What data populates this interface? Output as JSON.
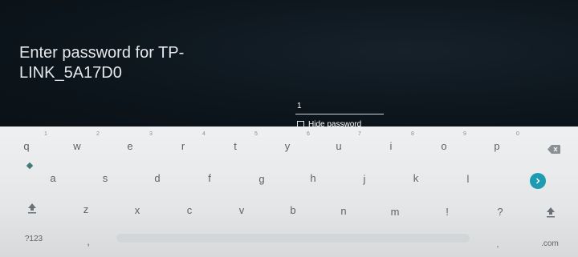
{
  "title": "Enter password for TP-\nLINK_5A17D0",
  "password_field": {
    "value": "1"
  },
  "hide_password_label": "Hide password",
  "keyboard": {
    "row1": [
      "q",
      "w",
      "e",
      "r",
      "t",
      "y",
      "u",
      "i",
      "o",
      "p"
    ],
    "row1_hints": [
      "1",
      "2",
      "3",
      "4",
      "5",
      "6",
      "7",
      "8",
      "9",
      "0"
    ],
    "row2": [
      "a",
      "s",
      "d",
      "f",
      "g",
      "h",
      "j",
      "k",
      "l"
    ],
    "row3": [
      "z",
      "x",
      "c",
      "v",
      "b",
      "n",
      "m",
      "!",
      "?"
    ],
    "symbols_label": "?123",
    "comma_label": ",",
    "period_label": ".",
    "com_label": ".com",
    "backspace_icon": "backspace-icon",
    "enter_icon": "enter-arrow-icon",
    "shift_icon": "shift-icon",
    "accent_color": "#1e9bb0"
  }
}
